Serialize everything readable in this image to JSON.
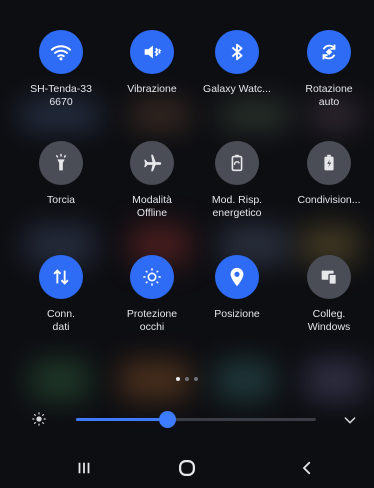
{
  "quick_settings": {
    "rows": [
      [
        {
          "label": "SH-Tenda-33\n6670",
          "icon": "wifi-icon",
          "active": true
        },
        {
          "label": "Vibrazione",
          "icon": "vibrate-icon",
          "active": true
        },
        {
          "label": "Galaxy Watc...",
          "icon": "bluetooth-icon",
          "active": true
        },
        {
          "label": "Rotazione\nauto",
          "icon": "auto-rotate-icon",
          "active": true
        }
      ],
      [
        {
          "label": "Torcia",
          "icon": "flashlight-icon",
          "active": false
        },
        {
          "label": "Modalità\nOffline",
          "icon": "airplane-icon",
          "active": false
        },
        {
          "label": "Mod. Risp.\nenergetico",
          "icon": "battery-saver-icon",
          "active": false
        },
        {
          "label": "Condivision...",
          "icon": "power-share-icon",
          "active": false
        }
      ],
      [
        {
          "label": "Conn.\ndati",
          "icon": "mobile-data-icon",
          "active": true
        },
        {
          "label": "Protezione\nocchi",
          "icon": "eye-comfort-icon",
          "active": true
        },
        {
          "label": "Posizione",
          "icon": "location-icon",
          "active": true
        },
        {
          "label": "Colleg.\nWindows",
          "icon": "link-windows-icon",
          "active": false
        }
      ]
    ]
  },
  "pager": {
    "count": 3,
    "active_index": 0
  },
  "brightness": {
    "level_fraction": 0.38
  },
  "navbar": {
    "recents": "recents-icon",
    "home": "home-icon",
    "back": "back-icon"
  },
  "colors": {
    "active_tile": "#2f6cf6",
    "inactive_tile": "#4a4d55",
    "background": "#0d0e12",
    "slider_accent": "#3d7bff"
  }
}
